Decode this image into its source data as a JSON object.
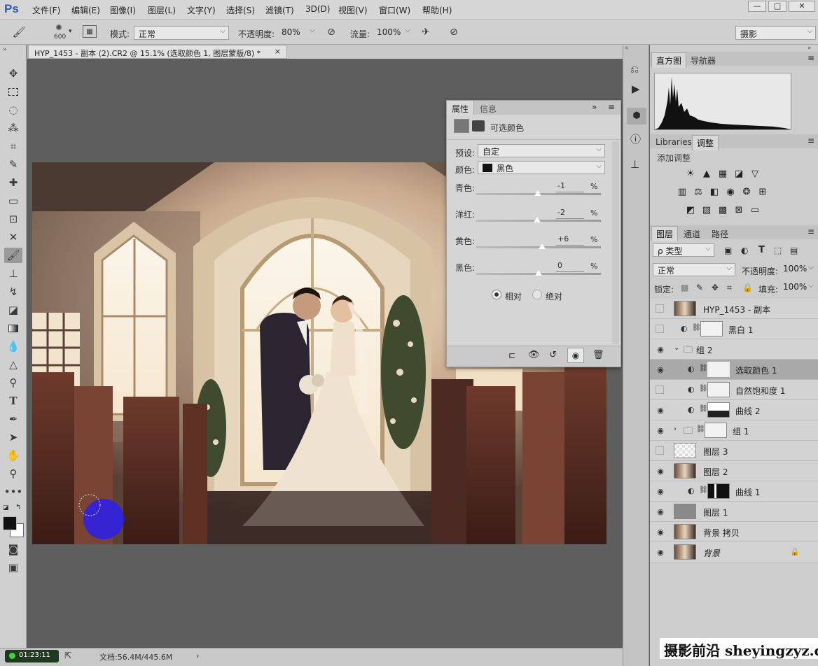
{
  "menu": {
    "items": [
      "文件(F)",
      "编辑(E)",
      "图像(I)",
      "图层(L)",
      "文字(Y)",
      "选择(S)",
      "滤镜(T)",
      "3D(D)",
      "视图(V)",
      "窗口(W)",
      "帮助(H)"
    ],
    "logo": "Ps"
  },
  "options": {
    "brush_size": "600",
    "mode_label": "模式:",
    "mode_value": "正常",
    "opacity_label": "不透明度:",
    "opacity_value": "80%",
    "flow_label": "流量:",
    "flow_value": "100%",
    "workspace": "摄影"
  },
  "document": {
    "tab_title": "HYP_1453 - 副本 (2).CR2 @ 15.1% (选取颜色 1, 图层蒙版/8) *",
    "tab_close": "×",
    "timer": "01:23:11",
    "doc_size": "文档:56.4M/445.6M"
  },
  "properties": {
    "tab_props": "属性",
    "tab_info": "信息",
    "title": "可选颜色",
    "preset_label": "预设:",
    "preset_value": "自定",
    "color_label": "颜色:",
    "color_value": "黑色",
    "sliders": [
      {
        "label": "青色:",
        "value": "-1",
        "unit": "%",
        "level": -1
      },
      {
        "label": "洋红:",
        "value": "-2",
        "unit": "%",
        "level": -2
      },
      {
        "label": "黄色:",
        "value": "+6",
        "unit": "%",
        "level": 6
      },
      {
        "label": "黑色:",
        "value": "0",
        "unit": "%",
        "level": 0
      }
    ],
    "radio_relative": "相对",
    "radio_absolute": "绝对",
    "relative_selected": true
  },
  "histogram": {
    "tab_histogram": "直方图",
    "tab_navigator": "导航器"
  },
  "adjustments": {
    "tab_libraries": "Libraries",
    "tab_adjust": "调整",
    "add_label": "添加调整"
  },
  "layers_panel": {
    "tab_layers": "图层",
    "tab_channels": "通道",
    "tab_paths": "路径",
    "filter_kind": "ρ 类型",
    "blend_mode": "正常",
    "opacity_label": "不透明度:",
    "opacity_value": "100%",
    "lock_label": "锁定:",
    "fill_label": "填充:",
    "fill_value": "100%",
    "layers": [
      {
        "name": "HYP_1453 - 副本",
        "visible": false,
        "kind": "photo",
        "indent": 0,
        "selected": false
      },
      {
        "name": "黑白 1",
        "visible": false,
        "kind": "adjust",
        "indent": 0,
        "selected": false
      },
      {
        "name": "组 2",
        "visible": true,
        "kind": "group-open",
        "indent": 0,
        "selected": false
      },
      {
        "name": "选取颜色 1",
        "visible": true,
        "kind": "adjust",
        "indent": 1,
        "selected": true
      },
      {
        "name": "自然饱和度 1",
        "visible": false,
        "kind": "adjust",
        "indent": 1,
        "selected": false
      },
      {
        "name": "曲线 2",
        "visible": true,
        "kind": "adjust-mask",
        "indent": 1,
        "selected": false
      },
      {
        "name": "组 1",
        "visible": true,
        "kind": "group-closed",
        "indent": 0,
        "selected": false
      },
      {
        "name": "图层 3",
        "visible": false,
        "kind": "transparent",
        "indent": 0,
        "selected": false
      },
      {
        "name": "图层 2",
        "visible": true,
        "kind": "photo",
        "indent": 0,
        "selected": false
      },
      {
        "name": "曲线 1",
        "visible": true,
        "kind": "adjust-dark",
        "indent": 1,
        "selected": false
      },
      {
        "name": "图层 1",
        "visible": true,
        "kind": "gray",
        "indent": 0,
        "selected": false
      },
      {
        "name": "背景 拷贝",
        "visible": true,
        "kind": "photo",
        "indent": 0,
        "selected": false
      },
      {
        "name": "背景",
        "visible": true,
        "kind": "photo",
        "indent": 0,
        "selected": false,
        "locked": true
      }
    ]
  },
  "watermark": "摄影前沿 sheyingzyz.com",
  "colors": {
    "foreground": "#111111",
    "background": "#ffffff",
    "brush_cursor": "#2a1ef0"
  }
}
